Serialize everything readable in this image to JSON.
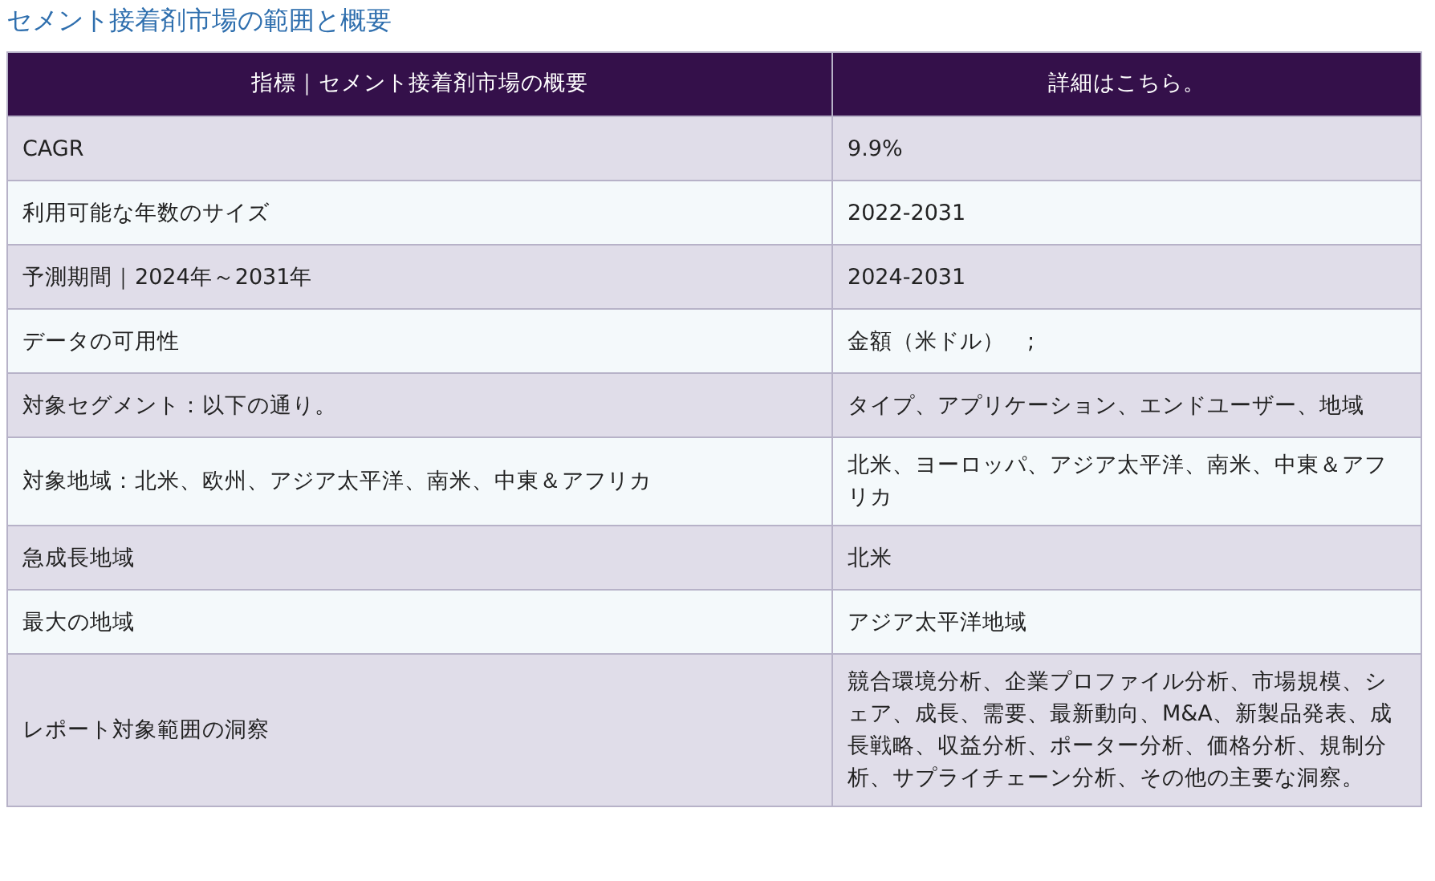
{
  "title": "セメント接着剤市場の範囲と概要",
  "table": {
    "columns": [
      "指標｜セメント接着剤市場の概要",
      "詳細はこちら。"
    ],
    "rows": [
      [
        "CAGR",
        "9.9%"
      ],
      [
        "利用可能な年数のサイズ",
        "2022-2031"
      ],
      [
        "予測期間｜2024年～2031年",
        "2024-2031"
      ],
      [
        "データの可用性",
        "金額（米ドル）　;"
      ],
      [
        "対象セグメント：以下の通り。",
        "タイプ、アプリケーション、エンドユーザー、地域"
      ],
      [
        "対象地域：北米、欧州、アジア太平洋、南米、中東＆アフリカ",
        "北米、ヨーロッパ、アジア太平洋、南米、中東＆アフリカ"
      ],
      [
        "急成長地域",
        "北米"
      ],
      [
        "最大の地域",
        "アジア太平洋地域"
      ],
      [
        "レポート対象範囲の洞察",
        "競合環境分析、企業プロファイル分析、市場規模、シェア、成長、需要、最新動向、M&A、新製品発表、成長戦略、収益分析、ポーター分析、価格分析、規制分析、サプライチェーン分析、その他の主要な洞察。"
      ]
    ]
  }
}
